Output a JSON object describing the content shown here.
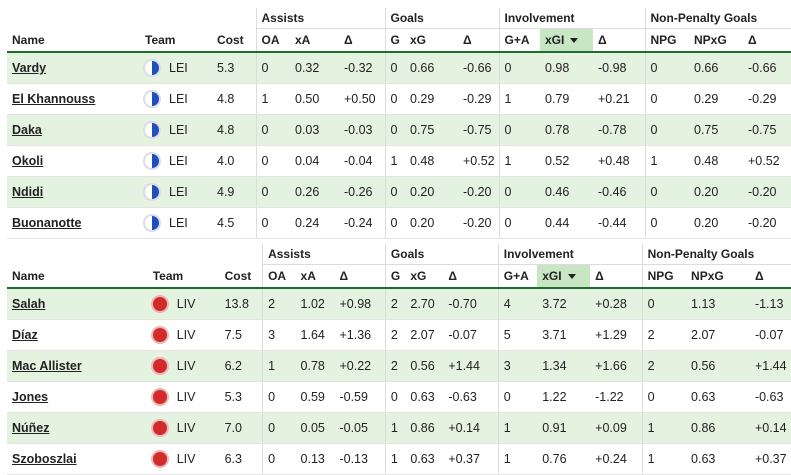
{
  "group_labels": {
    "assists": "Assists",
    "goals": "Goals",
    "involvement": "Involvement",
    "npg": "Non-Penalty Goals"
  },
  "columns": {
    "name": "Name",
    "team": "Team",
    "cost": "Cost",
    "oa": "OA",
    "xa": "xA",
    "da": "Δ",
    "g": "G",
    "xg": "xG",
    "dg": "Δ",
    "ga": "G+A",
    "xgi": "xGI",
    "di": "Δ",
    "npg": "NPG",
    "npxg": "NPxG",
    "dn": "Δ"
  },
  "tables": [
    {
      "team_code": "LEI",
      "logo_colors": [
        "#ffffff",
        "#1f4fbf"
      ],
      "rows": [
        {
          "name": "Vardy",
          "team": "LEI",
          "cost": "5.3",
          "oa": "0",
          "xa": "0.32",
          "da": "-0.32",
          "g": "0",
          "xg": "0.66",
          "dg": "-0.66",
          "ga": "0",
          "xgi": "0.98",
          "di": "-0.98",
          "npg": "0",
          "npxg": "0.66",
          "dn": "-0.66"
        },
        {
          "name": "El Khannouss",
          "team": "LEI",
          "cost": "4.8",
          "oa": "1",
          "xa": "0.50",
          "da": "+0.50",
          "g": "0",
          "xg": "0.29",
          "dg": "-0.29",
          "ga": "1",
          "xgi": "0.79",
          "di": "+0.21",
          "npg": "0",
          "npxg": "0.29",
          "dn": "-0.29"
        },
        {
          "name": "Daka",
          "team": "LEI",
          "cost": "4.8",
          "oa": "0",
          "xa": "0.03",
          "da": "-0.03",
          "g": "0",
          "xg": "0.75",
          "dg": "-0.75",
          "ga": "0",
          "xgi": "0.78",
          "di": "-0.78",
          "npg": "0",
          "npxg": "0.75",
          "dn": "-0.75"
        },
        {
          "name": "Okoli",
          "team": "LEI",
          "cost": "4.0",
          "oa": "0",
          "xa": "0.04",
          "da": "-0.04",
          "g": "1",
          "xg": "0.48",
          "dg": "+0.52",
          "ga": "1",
          "xgi": "0.52",
          "di": "+0.48",
          "npg": "1",
          "npxg": "0.48",
          "dn": "+0.52"
        },
        {
          "name": "Ndidi",
          "team": "LEI",
          "cost": "4.9",
          "oa": "0",
          "xa": "0.26",
          "da": "-0.26",
          "g": "0",
          "xg": "0.20",
          "dg": "-0.20",
          "ga": "0",
          "xgi": "0.46",
          "di": "-0.46",
          "npg": "0",
          "npxg": "0.20",
          "dn": "-0.20"
        },
        {
          "name": "Buonanotte",
          "team": "LEI",
          "cost": "4.5",
          "oa": "0",
          "xa": "0.24",
          "da": "-0.24",
          "g": "0",
          "xg": "0.20",
          "dg": "-0.20",
          "ga": "0",
          "xgi": "0.44",
          "di": "-0.44",
          "npg": "0",
          "npxg": "0.20",
          "dn": "-0.20"
        }
      ]
    },
    {
      "team_code": "LIV",
      "logo_colors": [
        "#d32b2b"
      ],
      "rows": [
        {
          "name": "Salah",
          "team": "LIV",
          "cost": "13.8",
          "oa": "2",
          "xa": "1.02",
          "da": "+0.98",
          "g": "2",
          "xg": "2.70",
          "dg": "-0.70",
          "ga": "4",
          "xgi": "3.72",
          "di": "+0.28",
          "npg": "0",
          "npxg": "1.13",
          "dn": "-1.13"
        },
        {
          "name": "Díaz",
          "team": "LIV",
          "cost": "7.5",
          "oa": "3",
          "xa": "1.64",
          "da": "+1.36",
          "g": "2",
          "xg": "2.07",
          "dg": "-0.07",
          "ga": "5",
          "xgi": "3.71",
          "di": "+1.29",
          "npg": "2",
          "npxg": "2.07",
          "dn": "-0.07"
        },
        {
          "name": "Mac Allister",
          "team": "LIV",
          "cost": "6.2",
          "oa": "1",
          "xa": "0.78",
          "da": "+0.22",
          "g": "2",
          "xg": "0.56",
          "dg": "+1.44",
          "ga": "3",
          "xgi": "1.34",
          "di": "+1.66",
          "npg": "2",
          "npxg": "0.56",
          "dn": "+1.44"
        },
        {
          "name": "Jones",
          "team": "LIV",
          "cost": "5.3",
          "oa": "0",
          "xa": "0.59",
          "da": "-0.59",
          "g": "0",
          "xg": "0.63",
          "dg": "-0.63",
          "ga": "0",
          "xgi": "1.22",
          "di": "-1.22",
          "npg": "0",
          "npxg": "0.63",
          "dn": "-0.63"
        },
        {
          "name": "Núñez",
          "team": "LIV",
          "cost": "7.0",
          "oa": "0",
          "xa": "0.05",
          "da": "-0.05",
          "g": "1",
          "xg": "0.86",
          "dg": "+0.14",
          "ga": "1",
          "xgi": "0.91",
          "di": "+0.09",
          "npg": "1",
          "npxg": "0.86",
          "dn": "+0.14"
        },
        {
          "name": "Szoboszlai",
          "team": "LIV",
          "cost": "6.3",
          "oa": "0",
          "xa": "0.13",
          "da": "-0.13",
          "g": "1",
          "xg": "0.63",
          "dg": "+0.37",
          "ga": "1",
          "xgi": "0.76",
          "di": "+0.24",
          "npg": "1",
          "npxg": "0.63",
          "dn": "+0.37"
        }
      ]
    }
  ],
  "sorted_column": "xgi",
  "colors": {
    "accent": "#1d6b2e",
    "row_alt": "#e4f2e0",
    "sorted_header": "#c8e6c4"
  }
}
